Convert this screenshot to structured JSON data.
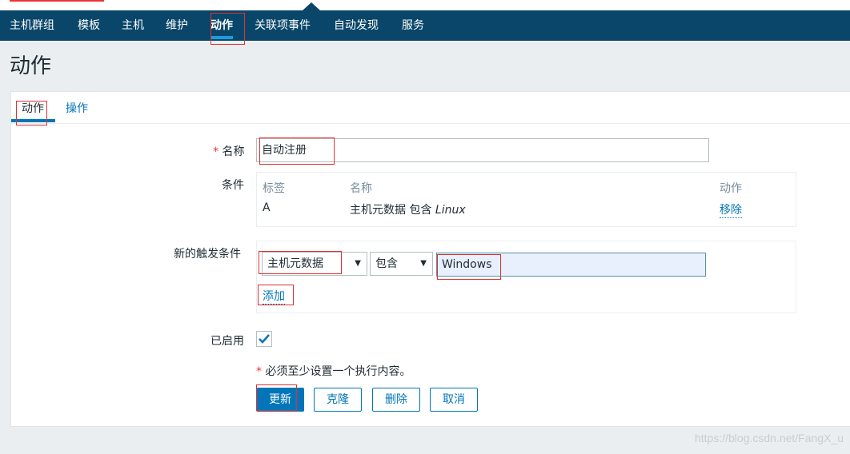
{
  "nav": {
    "items": [
      {
        "label": "主机群组"
      },
      {
        "label": "模板"
      },
      {
        "label": "主机"
      },
      {
        "label": "维护"
      },
      {
        "label": "动作",
        "active": true
      },
      {
        "label": "关联项事件"
      },
      {
        "label": "自动发现"
      },
      {
        "label": "服务"
      }
    ]
  },
  "page": {
    "title": "动作"
  },
  "tabs": [
    {
      "label": "动作",
      "active": true
    },
    {
      "label": "操作"
    }
  ],
  "form": {
    "name": {
      "label": "名称",
      "required_mark": "*",
      "value": "自动注册"
    },
    "conditions": {
      "label": "条件",
      "headers": {
        "tag": "标签",
        "name": "名称",
        "action": "动作"
      },
      "rows": [
        {
          "tag": "A",
          "name_prefix": "主机元数据 包含 ",
          "name_value": "Linux",
          "action": "移除"
        }
      ]
    },
    "new_condition": {
      "label": "新的触发条件",
      "type_select": "主机元数据",
      "operator_select": "包含",
      "value": "Windows",
      "add_link": "添加"
    },
    "enabled": {
      "label": "已启用",
      "checked": true
    },
    "note": {
      "mark": "*",
      "text": " 必须至少设置一个执行内容。"
    },
    "buttons": {
      "update": "更新",
      "clone": "克隆",
      "delete": "删除",
      "cancel": "取消"
    }
  },
  "watermark": "https://blog.csdn.net/FangX_u",
  "colors": {
    "nav_bg": "#0a466a",
    "accent": "#0275b8",
    "nav_active_underline": "#1f9ae0",
    "required": "#e33333",
    "annotation_box": "#e03030"
  }
}
